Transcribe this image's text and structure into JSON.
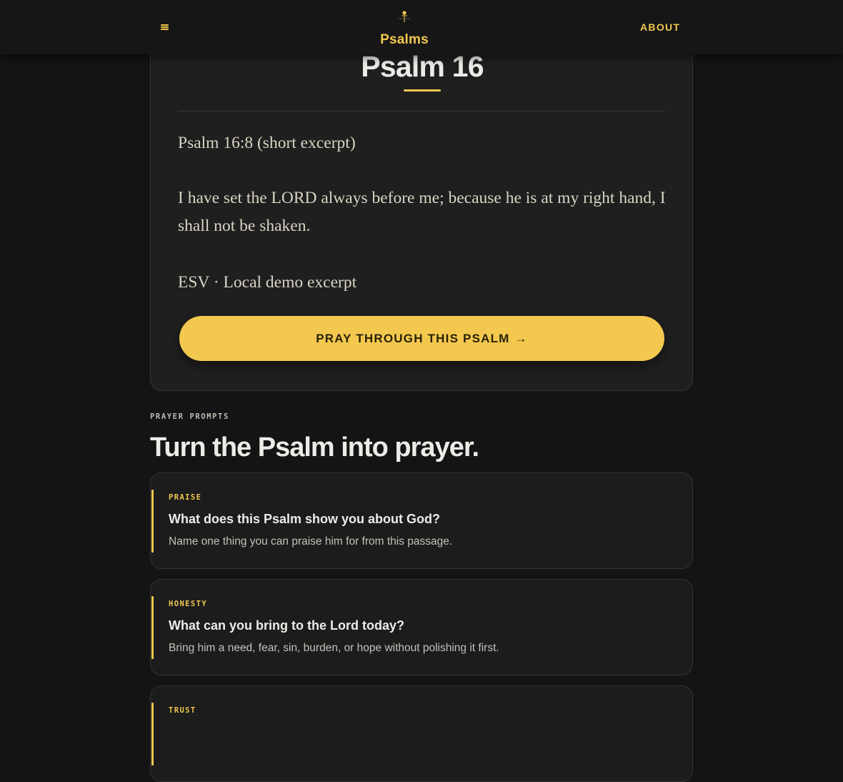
{
  "header": {
    "brand_title": "Psalms",
    "about_label": "ABOUT",
    "menu_icon": "hamburger-menu-icon",
    "brand_icon": "cross-sunrise-logo-icon",
    "accent_color": "#f2c84f"
  },
  "psalm": {
    "title": "Psalm 16",
    "reference": "Psalm 16:8 (short excerpt)",
    "verse": "I have set the LORD always before me; because he is at my right hand, I shall not be shaken.",
    "source": "ESV · Local demo excerpt",
    "pray_button_label": "PRAY THROUGH THIS PSALM",
    "pray_button_arrow": "→"
  },
  "prompts_section": {
    "eyebrow": "PRAYER PROMPTS",
    "heading": "Turn the Psalm into prayer.",
    "prompts": [
      {
        "tag": "PRAISE",
        "question": "What does this Psalm show you about God?",
        "description": "Name one thing you can praise him for from this passage."
      },
      {
        "tag": "HONESTY",
        "question": "What can you bring to the Lord today?",
        "description": "Bring him a need, fear, sin, burden, or hope without polishing it first."
      },
      {
        "tag": "TRUST"
      }
    ]
  }
}
